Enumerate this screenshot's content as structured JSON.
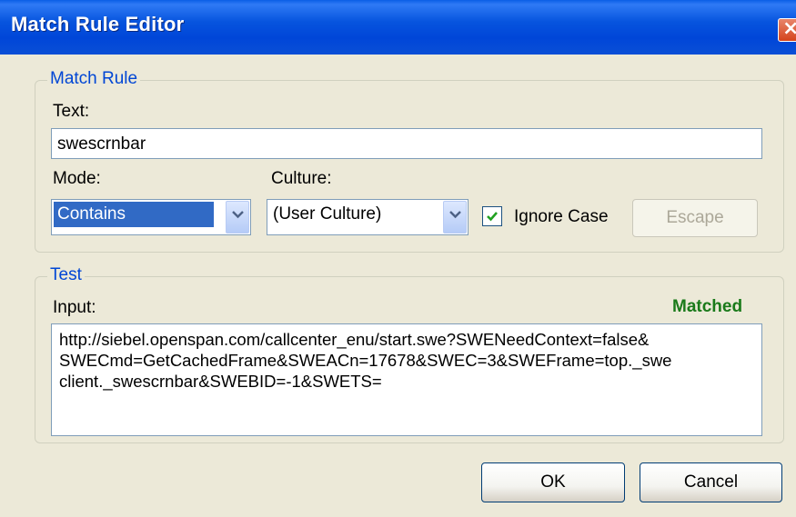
{
  "window": {
    "title": "Match Rule Editor"
  },
  "match_rule": {
    "legend": "Match Rule",
    "text_label": "Text:",
    "text_value": "swescrnbar",
    "mode_label": "Mode:",
    "mode_value": "Contains",
    "culture_label": "Culture:",
    "culture_value": "(User Culture)",
    "ignore_case_label": "Ignore Case",
    "ignore_case_checked": true,
    "escape_label": "Escape"
  },
  "test": {
    "legend": "Test",
    "input_label": "Input:",
    "status": "Matched",
    "status_color": "#1a7a1a",
    "input_value": "http://siebel.openspan.com/callcenter_enu/start.swe?SWENeedContext=false&\nSWECmd=GetCachedFrame&SWEACn=17678&SWEC=3&SWEFrame=top._swe\nclient._swescrnbar&SWEBID=-1&SWETS="
  },
  "buttons": {
    "ok": "OK",
    "cancel": "Cancel"
  },
  "icons": {
    "close": "close-icon",
    "dropdown": "chevron-down-icon",
    "check": "checkmark-icon"
  }
}
